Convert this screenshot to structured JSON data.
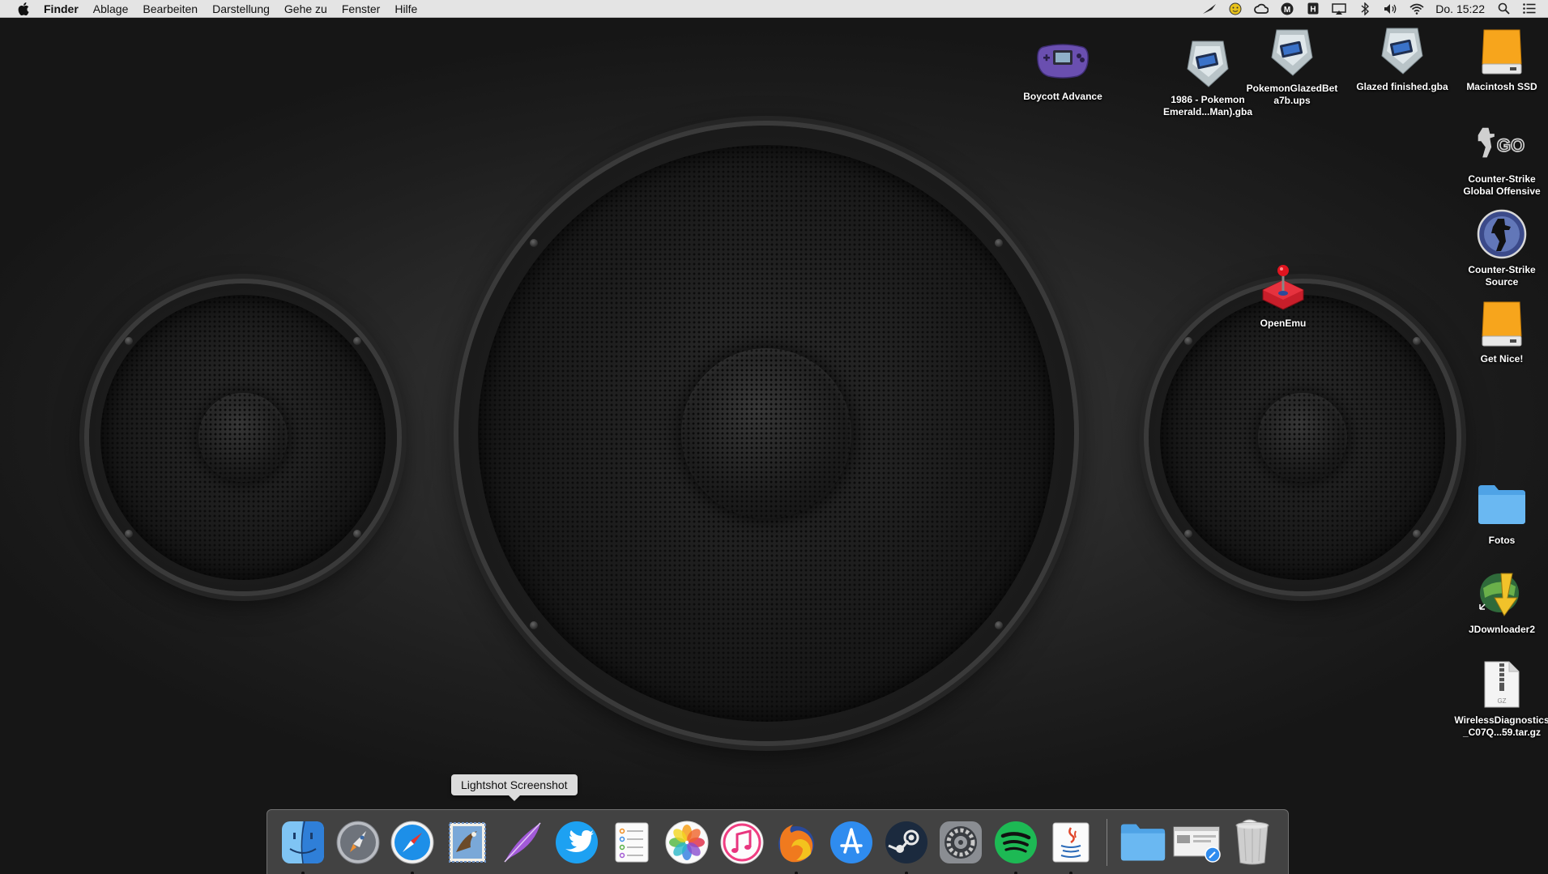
{
  "menubar": {
    "app_name": "Finder",
    "menus": [
      "Ablage",
      "Bearbeiten",
      "Darstellung",
      "Gehe zu",
      "Fenster",
      "Hilfe"
    ],
    "clock": "Do. 15:22",
    "status_icons": [
      "quill-icon",
      "smiley-icon",
      "creative-cloud-icon",
      "m-icon",
      "h-icon",
      "airplay-icon",
      "bluetooth-icon",
      "volume-icon",
      "wifi-icon",
      "spotlight-icon",
      "notification-center-icon"
    ]
  },
  "desktop_icons": [
    {
      "name": "boycott-advance",
      "label": "Boycott Advance",
      "icon": "gameboy-advance-icon"
    },
    {
      "name": "pokemon-emerald",
      "label": "1986 - Pokemon Emerald...Man).gba",
      "icon": "rom-cartridge-icon"
    },
    {
      "name": "pokemon-glazed-ups",
      "label": "PokemonGlazedBeta7b.ups",
      "icon": "rom-cartridge-icon"
    },
    {
      "name": "glazed-finished",
      "label": "Glazed finished.gba",
      "icon": "rom-cartridge-icon"
    },
    {
      "name": "macintosh-ssd",
      "label": "Macintosh SSD",
      "icon": "drive-icon"
    },
    {
      "name": "csgo",
      "label": "Counter-Strike Global Offensive",
      "icon": "csgo-icon"
    },
    {
      "name": "cs-source",
      "label": "Counter-Strike Source",
      "icon": "css-icon"
    },
    {
      "name": "openemu",
      "label": "OpenEmu",
      "icon": "joystick-icon"
    },
    {
      "name": "get-nice",
      "label": "Get Nice!",
      "icon": "drive-icon"
    },
    {
      "name": "fotos",
      "label": "Fotos",
      "icon": "folder-icon"
    },
    {
      "name": "jdownloader",
      "label": "JDownloader2",
      "icon": "jdownloader-icon"
    },
    {
      "name": "wireless-diag",
      "label": "WirelessDiagnostics_C07Q...59.tar.gz",
      "icon": "gz-archive-icon"
    }
  ],
  "dock": {
    "tooltip": "Lightshot Screenshot",
    "items": [
      {
        "name": "finder",
        "icon": "finder-icon",
        "running": true
      },
      {
        "name": "launchpad",
        "icon": "launchpad-icon",
        "running": false
      },
      {
        "name": "safari",
        "icon": "safari-icon",
        "running": true
      },
      {
        "name": "mail",
        "icon": "mail-icon",
        "running": false
      },
      {
        "name": "lightshot",
        "icon": "lightshot-feather-icon",
        "running": false
      },
      {
        "name": "twitter",
        "icon": "twitter-icon",
        "running": false
      },
      {
        "name": "reminders",
        "icon": "reminders-icon",
        "running": false
      },
      {
        "name": "photos",
        "icon": "photos-icon",
        "running": false
      },
      {
        "name": "itunes",
        "icon": "itunes-icon",
        "running": false
      },
      {
        "name": "firefox",
        "icon": "firefox-icon",
        "running": true
      },
      {
        "name": "app-store",
        "icon": "app-store-icon",
        "running": false
      },
      {
        "name": "steam",
        "icon": "steam-icon",
        "running": true
      },
      {
        "name": "system-preferences",
        "icon": "system-preferences-icon",
        "running": false
      },
      {
        "name": "spotify",
        "icon": "spotify-icon",
        "running": true
      },
      {
        "name": "java",
        "icon": "java-icon",
        "running": true
      }
    ],
    "right_items": [
      {
        "name": "folder-stack",
        "icon": "folder-icon"
      },
      {
        "name": "downloads-stack",
        "icon": "downloads-stack-icon"
      },
      {
        "name": "trash",
        "icon": "trash-icon"
      }
    ]
  }
}
